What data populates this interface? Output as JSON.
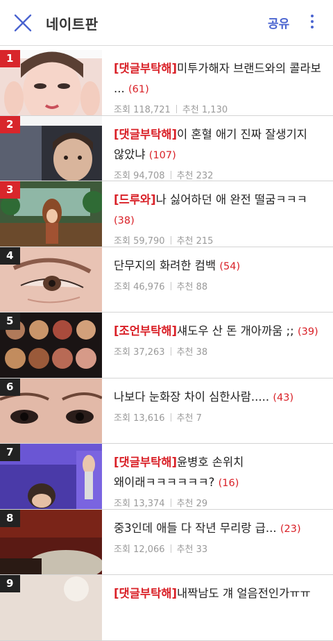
{
  "header": {
    "title": "네이트판",
    "share_label": "공유",
    "close_icon": "close-icon",
    "more_icon": "more-vertical-icon",
    "accent_color": "#4a64d0"
  },
  "items": [
    {
      "rank": "1",
      "tag": "[댓글부탁해]",
      "title": "미투가해자 브랜드와의 콜라보 ...",
      "count": "(61)",
      "views_label": "조회",
      "views": "118,721",
      "rec_label": "추천",
      "recs": "1,130"
    },
    {
      "rank": "2",
      "tag": "[댓글부탁해]",
      "title": "이 혼혈 애기 진짜 잘생기지 않았냐",
      "count": "(107)",
      "views_label": "조회",
      "views": "94,708",
      "rec_label": "추천",
      "recs": "232"
    },
    {
      "rank": "3",
      "tag": "[드루와]",
      "title": "나 싫어하던 애 완전 떨굼ㅋㅋㅋ",
      "count": "(38)",
      "views_label": "조회",
      "views": "59,790",
      "rec_label": "추천",
      "recs": "215"
    },
    {
      "rank": "4",
      "tag": "",
      "title": "단무지의 화려한 컴백",
      "count": "(54)",
      "views_label": "조회",
      "views": "46,976",
      "rec_label": "추천",
      "recs": "88"
    },
    {
      "rank": "5",
      "tag": "[조언부탁해]",
      "title": "섀도우 산 돈 개아까움 ;;",
      "count": "(39)",
      "views_label": "조회",
      "views": "37,263",
      "rec_label": "추천",
      "recs": "38"
    },
    {
      "rank": "6",
      "tag": "",
      "title": "나보다 눈화장 차이 심한사람.....",
      "count": "(43)",
      "views_label": "조회",
      "views": "13,616",
      "rec_label": "추천",
      "recs": "7"
    },
    {
      "rank": "7",
      "tag": "[댓글부탁해]",
      "title": "윤병호 손위치 왜이래ㅋㅋㅋㅋㅋㅋ?",
      "count": "(16)",
      "views_label": "조회",
      "views": "13,374",
      "rec_label": "추천",
      "recs": "29"
    },
    {
      "rank": "8",
      "tag": "",
      "title": "중3인데 애들 다 작년 무리랑 급...",
      "count": "(23)",
      "views_label": "조회",
      "views": "12,066",
      "rec_label": "추천",
      "recs": "33"
    },
    {
      "rank": "9",
      "tag": "[댓글부탁해]",
      "title": "내짝남도 걔 얼음전인가ㅠㅠ",
      "count": "",
      "views_label": "",
      "views": "",
      "rec_label": "",
      "recs": ""
    }
  ],
  "thumb_icons": [
    "thumbnail-image",
    "thumbnail-image",
    "thumbnail-image",
    "thumbnail-image",
    "thumbnail-image",
    "thumbnail-image",
    "thumbnail-image",
    "thumbnail-image",
    "thumbnail-image"
  ]
}
